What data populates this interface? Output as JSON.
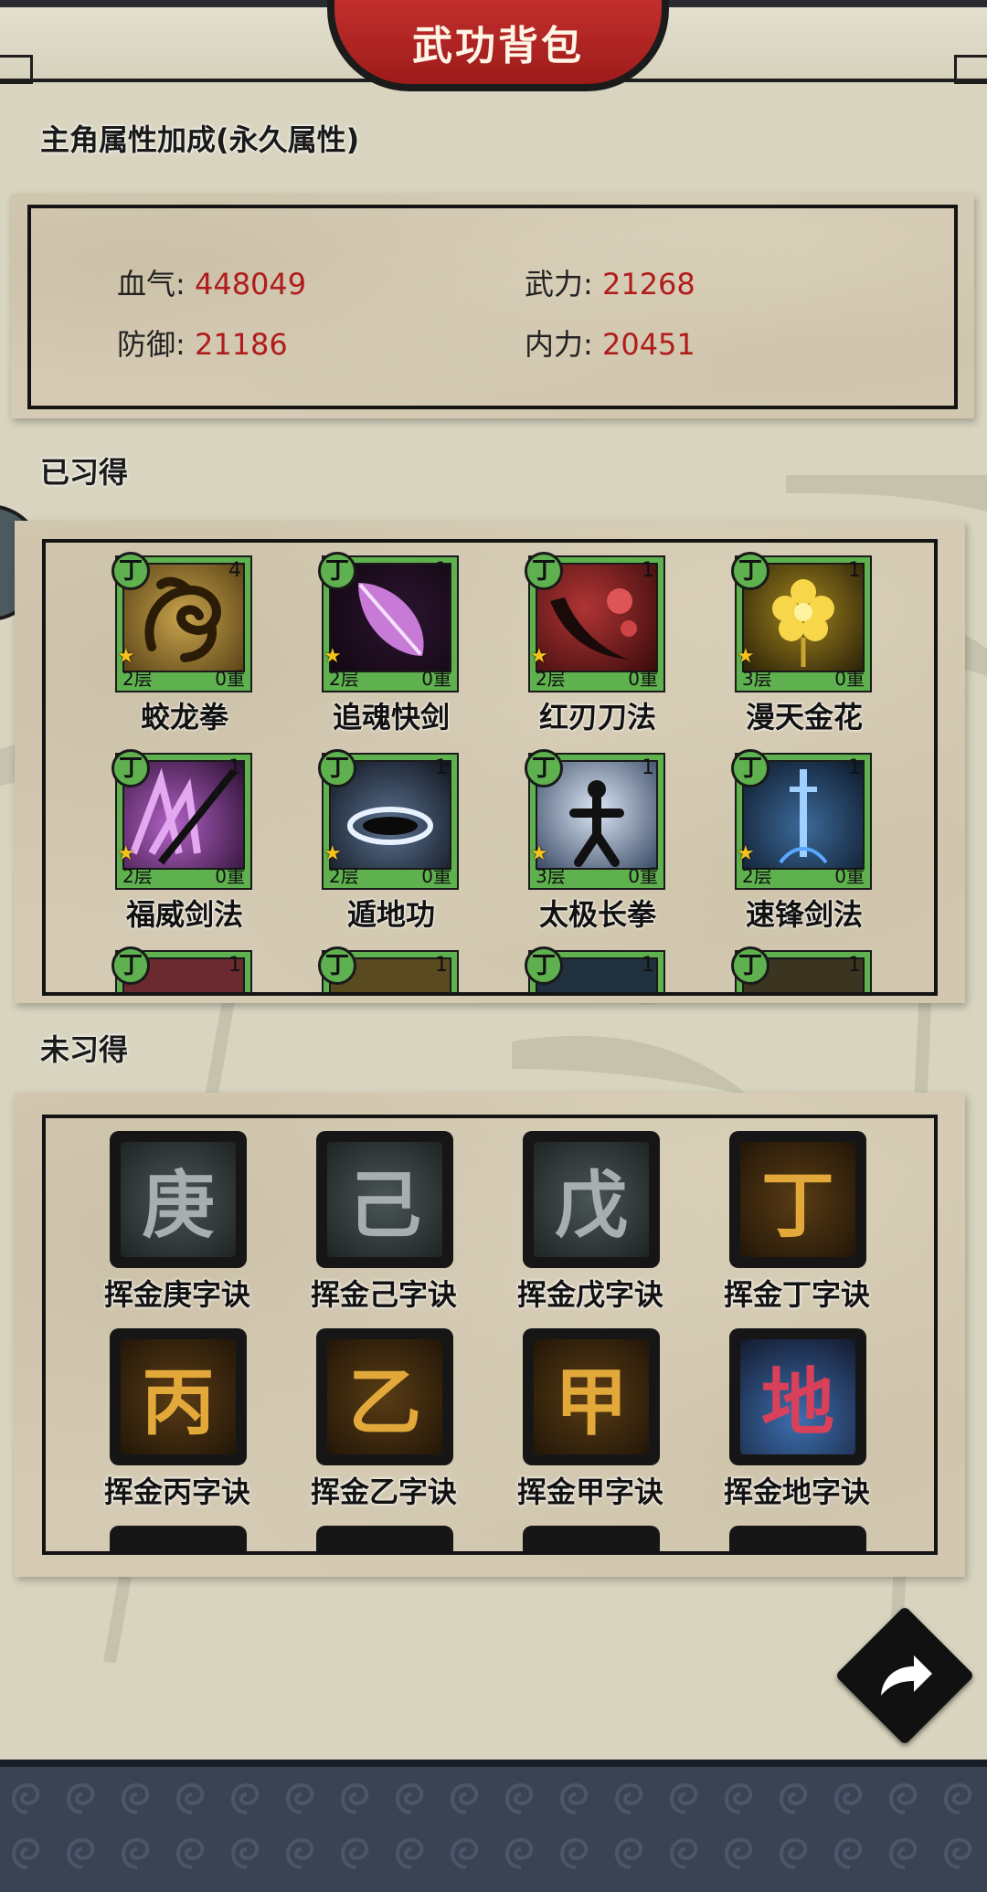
{
  "header": {
    "title": "武功背包"
  },
  "attributes": {
    "section_label": "主角属性加成(永久属性)",
    "stats": [
      {
        "label": "血气:",
        "value": "448049"
      },
      {
        "label": "武力:",
        "value": "21268"
      },
      {
        "label": "防御:",
        "value": "21186"
      },
      {
        "label": "内力:",
        "value": "20451"
      }
    ]
  },
  "learned": {
    "section_label": "已习得",
    "skills": [
      {
        "name": "蛟龙拳",
        "grade": "丁",
        "level": "4",
        "layer": "2层",
        "weight": "0重",
        "icon": "dragon-icon"
      },
      {
        "name": "追魂快剑",
        "grade": "丁",
        "level": "1",
        "layer": "2层",
        "weight": "0重",
        "icon": "purple-feather-icon"
      },
      {
        "name": "红刃刀法",
        "grade": "丁",
        "level": "1",
        "layer": "2层",
        "weight": "0重",
        "icon": "red-blade-icon"
      },
      {
        "name": "漫天金花",
        "grade": "丁",
        "level": "1",
        "layer": "3层",
        "weight": "0重",
        "icon": "golden-flower-icon"
      },
      {
        "name": "福威剑法",
        "grade": "丁",
        "level": "1",
        "layer": "2层",
        "weight": "0重",
        "icon": "purple-sword-slash-icon"
      },
      {
        "name": "遁地功",
        "grade": "丁",
        "level": "1",
        "layer": "2层",
        "weight": "0重",
        "icon": "ground-shockwave-icon"
      },
      {
        "name": "太极长拳",
        "grade": "丁",
        "level": "1",
        "layer": "3层",
        "weight": "0重",
        "icon": "taiji-fighter-icon"
      },
      {
        "name": "速锋剑法",
        "grade": "丁",
        "level": "1",
        "layer": "2层",
        "weight": "0重",
        "icon": "blue-sword-icon"
      }
    ],
    "partial_row": [
      {
        "grade": "丁",
        "level": "1"
      },
      {
        "grade": "丁",
        "level": "1"
      },
      {
        "grade": "丁",
        "level": "1"
      },
      {
        "grade": "丁",
        "level": "1"
      }
    ]
  },
  "unlearned": {
    "section_label": "未习得",
    "items": [
      {
        "name": "挥金庚字诀",
        "char": "庚",
        "theme": "gray"
      },
      {
        "name": "挥金己字诀",
        "char": "己",
        "theme": "gray"
      },
      {
        "name": "挥金戊字诀",
        "char": "戊",
        "theme": "gray"
      },
      {
        "name": "挥金丁字诀",
        "char": "丁",
        "theme": "gold"
      },
      {
        "name": "挥金丙字诀",
        "char": "丙",
        "theme": "gold"
      },
      {
        "name": "挥金乙字诀",
        "char": "乙",
        "theme": "gold"
      },
      {
        "name": "挥金甲字诀",
        "char": "甲",
        "theme": "gold"
      },
      {
        "name": "挥金地字诀",
        "char": "地",
        "theme": "red-blue"
      }
    ]
  },
  "share_button": {
    "icon": "share-arrow-icon"
  }
}
